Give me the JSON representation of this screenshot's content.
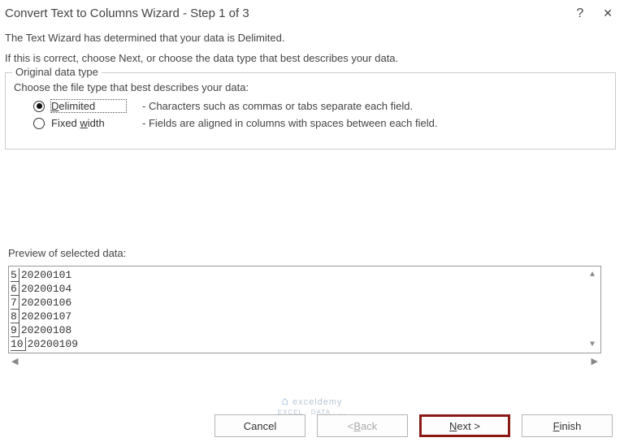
{
  "title": "Convert Text to Columns Wizard - Step 1 of 3",
  "intro1": "The Text Wizard has determined that your data is Delimited.",
  "intro2": "If this is correct, choose Next, or choose the data type that best describes your data.",
  "group": {
    "legend": "Original data type",
    "choose": "Choose the file type that best describes your data:",
    "delimited": {
      "letter": "D",
      "rest": "elimited",
      "desc": "- Characters such as commas or tabs separate each field."
    },
    "fixed": {
      "pre": "Fixed ",
      "letter": "w",
      "post": "idth",
      "desc": "- Fields are aligned in columns with spaces between each field."
    }
  },
  "preview": {
    "title": "Preview of selected data:",
    "rows": [
      {
        "n": "5",
        "v": "20200101"
      },
      {
        "n": "6",
        "v": "20200104"
      },
      {
        "n": "7",
        "v": "20200106"
      },
      {
        "n": "8",
        "v": "20200107"
      },
      {
        "n": "9",
        "v": "20200108"
      },
      {
        "n": "10",
        "v": "20200109"
      }
    ]
  },
  "buttons": {
    "cancel": "Cancel",
    "back_lt": "< ",
    "back_u": "B",
    "back_rest": "ack",
    "next_u": "N",
    "next_rest": "ext >",
    "finish_u": "F",
    "finish_rest": "inish"
  },
  "watermark": {
    "brand": "exceldemy",
    "tag": "EXCEL · DATA · ..."
  }
}
